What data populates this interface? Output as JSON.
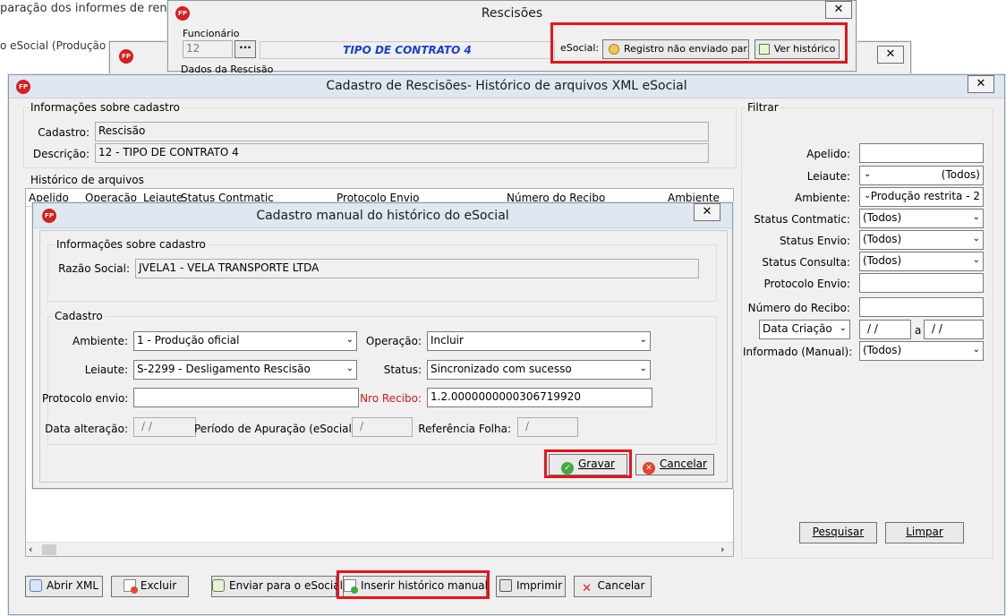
{
  "background": {
    "line1": "paração dos informes de rendir",
    "line2": "o eSocial (Produção restr"
  },
  "rescisoes": {
    "title": "Rescisões",
    "funcionario_label": "Funcionário",
    "funcionario_value": "12",
    "contract_type": "TIPO DE CONTRATO 4",
    "dados_label": "Dados da Rescisão",
    "esocial_label": "eSocial:",
    "registro_btn": "Registro não enviado para o",
    "ver_historico_btn": "Ver histórico"
  },
  "historico_window": {
    "title": "Cadastro de Rescisões- Histórico de arquivos XML eSocial",
    "info_group": "Informações sobre cadastro",
    "cadastro_label": "Cadastro:",
    "cadastro_value": "Rescisão",
    "descricao_label": "Descrição:",
    "descricao_value": "12 - TIPO DE CONTRATO 4",
    "historico_group": "Histórico de arquivos",
    "columns": [
      "Apelido",
      "Operação",
      "Leiaute",
      "Status Contmatic",
      "Protocolo Envio",
      "Número do Recibo",
      "Ambiente"
    ],
    "filter": {
      "group": "Filtrar",
      "apelido_label": "Apelido:",
      "apelido_value": "",
      "leiaute_label": "Leiaute:",
      "leiaute_value": "(Todos)",
      "ambiente_label": "Ambiente:",
      "ambiente_value": "Produção restrita - 2",
      "status_contmatic_label": "Status Contmatic:",
      "status_contmatic_value": "(Todos)",
      "status_envio_label": "Status Envio:",
      "status_envio_value": "(Todos)",
      "status_consulta_label": "Status Consulta:",
      "status_consulta_value": "(Todos)",
      "protocolo_label": "Protocolo Envio:",
      "recibo_label": "Número do Recibo:",
      "data_select": "Data Criação",
      "date_from": "/ /",
      "date_sep": "a",
      "date_to": "/ /",
      "informado_label": "Informado (Manual):",
      "informado_value": "(Todos)",
      "pesquisar_btn": "Pesquisar",
      "limpar_btn": "Limpar"
    },
    "buttons": {
      "abrir_xml": "Abrir XML",
      "excluir": "Excluir",
      "enviar": "Enviar para o eSocial",
      "inserir": "Inserir histórico manual",
      "imprimir": "Imprimir",
      "cancelar": "Cancelar"
    }
  },
  "manual_dialog": {
    "title": "Cadastro manual do histórico do eSocial",
    "info_group": "Informações sobre cadastro",
    "razao_label": "Razão Social:",
    "razao_value": "JVELA1 - VELA TRANSPORTE LTDA",
    "cadastro_group": "Cadastro",
    "ambiente_label": "Ambiente:",
    "ambiente_value": "1 - Produção oficial",
    "operacao_label": "Operação:",
    "operacao_value": "Incluir",
    "leiaute_label": "Leiaute:",
    "leiaute_value": "S-2299 - Desligamento Rescisão",
    "status_label": "Status:",
    "status_value": "Sincronizado com sucesso",
    "protocolo_label": "Protocolo envio:",
    "protocolo_value": "",
    "nro_recibo_label": "Nro Recibo:",
    "nro_recibo_value": "1.2.0000000000306719920",
    "data_alteracao_label": "Data alteração:",
    "data_alteracao_value": "/ /",
    "periodo_label": "Período de Apuração (eSocial):",
    "periodo_value": "/",
    "referencia_label": "Referência Folha:",
    "referencia_value": "/",
    "gravar_btn": "Gravar",
    "cancelar_btn": "Cancelar"
  },
  "colors": {
    "highlight": "#e8131a",
    "contract_blue": "#1a3fcf",
    "required_red": "#d61b1b",
    "fp_logo": "#d6201f"
  }
}
